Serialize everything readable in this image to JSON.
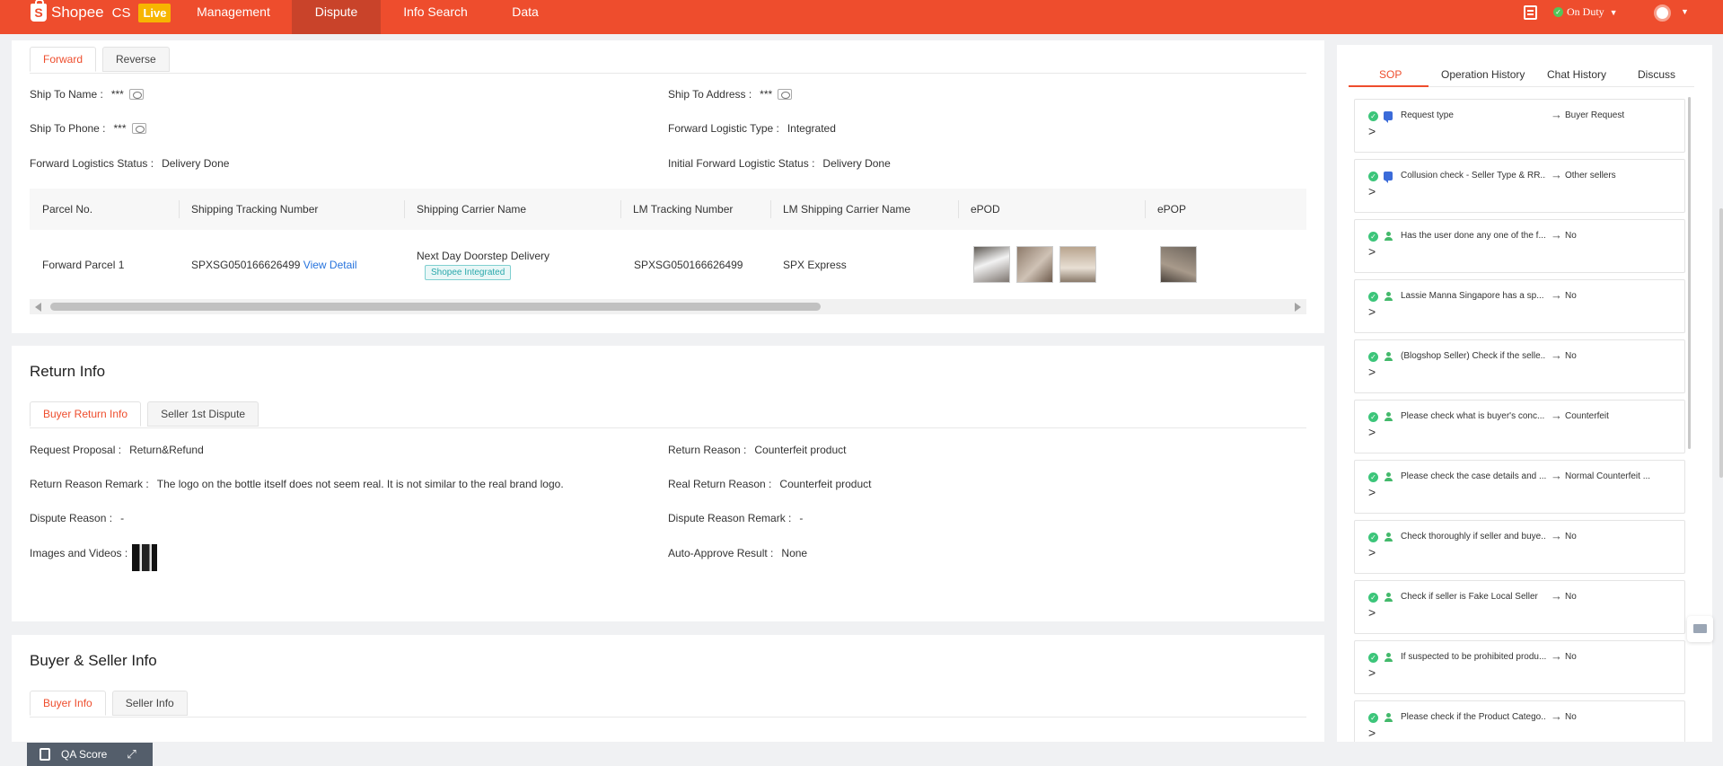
{
  "header": {
    "brand": "Shopee",
    "app": "CS",
    "env_badge": "Live",
    "nav": [
      "Management",
      "Dispute",
      "Info Search",
      "Data"
    ],
    "duty_status": "On Duty"
  },
  "logistics": {
    "tabs": [
      "Forward",
      "Reverse"
    ],
    "fields": {
      "ship_to_name_label": "Ship To Name :",
      "ship_to_name": "***",
      "ship_to_address_label": "Ship To Address :",
      "ship_to_address": "***",
      "ship_to_phone_label": "Ship To Phone :",
      "ship_to_phone": "***",
      "forward_type_label": "Forward Logistic Type :",
      "forward_type": "Integrated",
      "forward_status_label": "Forward Logistics Status :",
      "forward_status": "Delivery Done",
      "initial_status_label": "Initial Forward Logistic Status :",
      "initial_status": "Delivery Done"
    },
    "table": {
      "headers": [
        "Parcel No.",
        "Shipping Tracking Number",
        "Shipping Carrier Name",
        "LM Tracking Number",
        "LM Shipping Carrier Name",
        "ePOD",
        "ePOP"
      ],
      "row": {
        "parcel_no": "Forward Parcel 1",
        "tracking_number": "SPXSG050166626499",
        "view_detail": "View Detail",
        "carrier_name": "Next Day Doorstep Delivery",
        "carrier_badge": "Shopee Integrated",
        "lm_tracking": "SPXSG050166626499",
        "lm_carrier": "SPX Express"
      }
    }
  },
  "return_info": {
    "title": "Return Info",
    "tabs": [
      "Buyer Return Info",
      "Seller 1st Dispute"
    ],
    "fields": {
      "request_proposal_label": "Request Proposal :",
      "request_proposal": "Return&Refund",
      "return_reason_label": "Return Reason :",
      "return_reason": "Counterfeit product",
      "remark_label": "Return Reason Remark :",
      "remark": "The logo on the bottle itself does not seem real. It is not similar to the real brand logo.",
      "real_reason_label": "Real Return Reason :",
      "real_reason": "Counterfeit product",
      "dispute_reason_label": "Dispute Reason :",
      "dispute_reason": "-",
      "dispute_remark_label": "Dispute Reason Remark :",
      "dispute_remark": "-",
      "images_label": "Images and Videos :",
      "auto_approve_label": "Auto-Approve Result :",
      "auto_approve": "None"
    }
  },
  "buyer_seller": {
    "title": "Buyer & Seller Info",
    "tabs": [
      "Buyer Info",
      "Seller Info"
    ]
  },
  "right_panel": {
    "tabs": [
      "SOP",
      "Operation History",
      "Chat History",
      "Discuss"
    ],
    "sop_items": [
      {
        "q": "Request type",
        "a": "Buyer Request",
        "icon": "chat-icon"
      },
      {
        "q": "Collusion check - Seller Type & RR...",
        "a": "Other sellers",
        "icon": "chat-icon"
      },
      {
        "q": "Has the user done any one of the f...",
        "a": "No",
        "icon": "user-icon"
      },
      {
        "q": "Lassie Manna Singapore has a sp...",
        "a": "No",
        "icon": "user-icon"
      },
      {
        "q": "(Blogshop Seller) Check if the selle...",
        "a": "No",
        "icon": "user-icon"
      },
      {
        "q": "Please check what is buyer's conc...",
        "a": "Counterfeit",
        "icon": "user-icon"
      },
      {
        "q": "Please check the case details and ...",
        "a": "Normal Counterfeit ...",
        "icon": "user-icon"
      },
      {
        "q": "Check thoroughly if seller and buye...",
        "a": "No",
        "icon": "user-icon"
      },
      {
        "q": "Check if seller is Fake Local Seller",
        "a": "No",
        "icon": "user-icon"
      },
      {
        "q": "If suspected to be prohibited produ...",
        "a": "No",
        "icon": "user-icon"
      },
      {
        "q": "Please check if the Product Catego...",
        "a": "No",
        "icon": "user-icon"
      }
    ]
  },
  "qa": {
    "label": "QA Score"
  },
  "colors": {
    "brand": "#ee4d2d",
    "success": "#3cc57a",
    "link": "#2673dd"
  }
}
